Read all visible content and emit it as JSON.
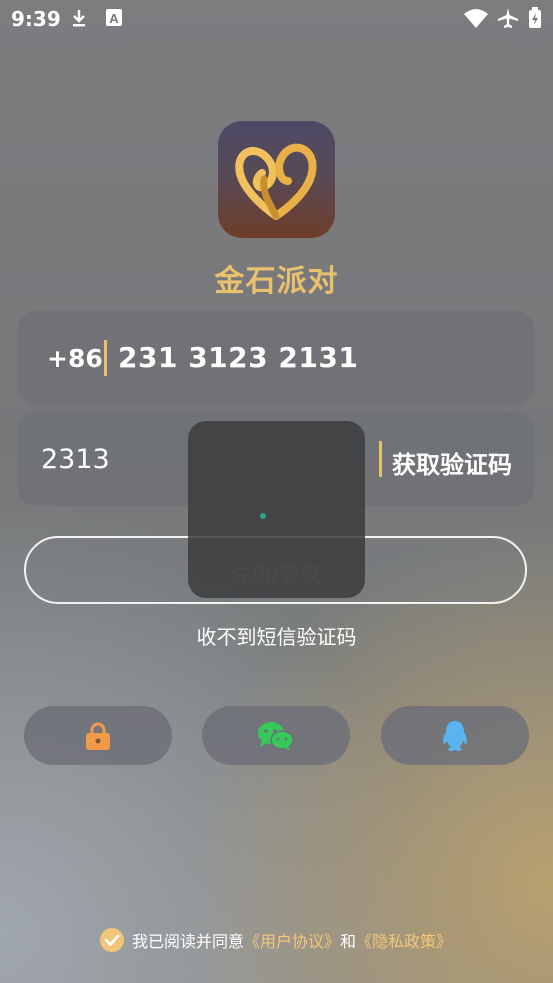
{
  "status_bar": {
    "time": "9:39",
    "icons": [
      "download-icon",
      "font-icon",
      "wifi-icon",
      "airplane-icon",
      "battery-icon"
    ]
  },
  "app": {
    "name": "金石派对",
    "logo_icon": "heart-knot-icon"
  },
  "phone": {
    "country_code": "+86",
    "number": "231 3123 2131"
  },
  "code": {
    "value": "2313",
    "get_code_label": "获取验证码"
  },
  "login_button": {
    "label": "注册/登录"
  },
  "no_code_link": "收不到短信验证码",
  "social": [
    {
      "name": "password-login",
      "icon": "lock-icon"
    },
    {
      "name": "wechat-login",
      "icon": "wechat-icon"
    },
    {
      "name": "qq-login",
      "icon": "qq-icon"
    }
  ],
  "agreement": {
    "checked": true,
    "prefix": "我已阅读并同意",
    "user_agreement": "《用户协议》",
    "and": "和",
    "privacy_policy": "《隐私政策》"
  },
  "colors": {
    "accent": "#e9c06e",
    "lock": "#f39a4a",
    "wechat": "#35c95a",
    "qq": "#5ab4f0",
    "spinner": "#2aa58c"
  }
}
